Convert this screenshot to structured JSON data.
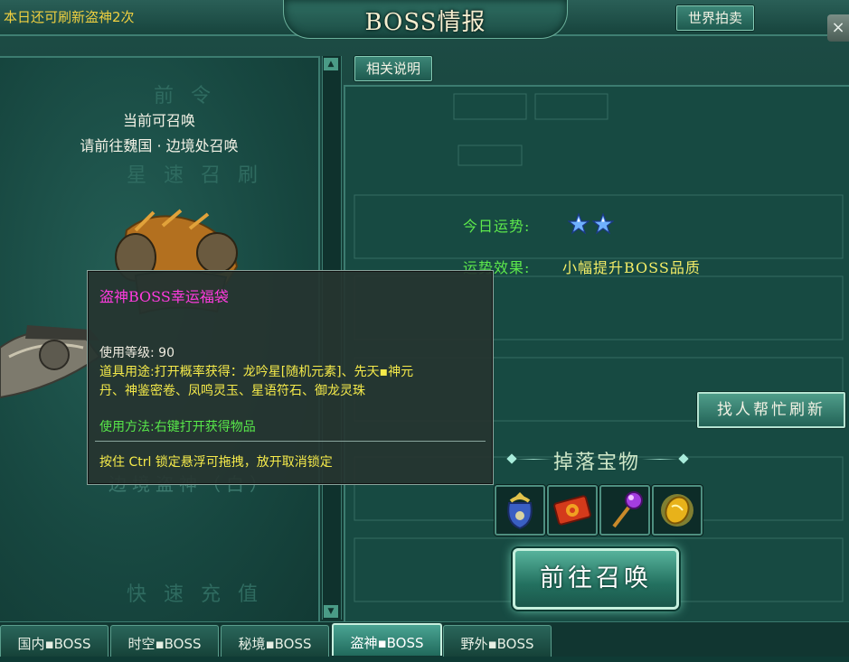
{
  "header": {
    "refresh_notice": "本日还可刷新盗神2次",
    "title": "BOSS情报",
    "world_auction_label": "世界拍卖",
    "close_symbol": "×"
  },
  "left_panel": {
    "summon_status": "当前可召唤",
    "summon_location": "请前往魏国 · 边境处召唤",
    "boss_name": "边境盗神（白）",
    "faint_top_text": "前 令",
    "faint_mid_text": "星 速 召 刷",
    "faint_bottom_text": "快 速 充 值"
  },
  "right_panel": {
    "explain_tab_label": "相关说明",
    "luck_today_label": "今日运势:",
    "luck_stars": 2,
    "luck_effect_label": "运势效果:",
    "luck_effect_value": "小幅提升BOSS品质",
    "help_refresh_label": "找人帮忙刷新",
    "drops_title": "掉落宝物",
    "drop_items": [
      "blue-pouch-icon",
      "red-token-icon",
      "purple-scepter-icon",
      "golden-jade-icon"
    ],
    "summon_button_label": "前往召唤"
  },
  "tooltip": {
    "title": "盗神BOSS幸运福袋",
    "level_line": "使用等级: 90",
    "usage_line1": "道具用途:打开概率获得：龙吟星[随机元素]、先天▪神元",
    "usage_line2": "丹、神鉴密卷、凤鸣灵玉、星语符石、御龙灵珠",
    "method_line": "使用方法:右键打开获得物品",
    "lock_hint": "按住 Ctrl 锁定悬浮可拖拽，放开取消锁定"
  },
  "bottom_tabs": [
    {
      "label": "国内▪BOSS",
      "active": false
    },
    {
      "label": "时空▪BOSS",
      "active": false
    },
    {
      "label": "秘境▪BOSS",
      "active": false
    },
    {
      "label": "盗神▪BOSS",
      "active": true
    },
    {
      "label": "野外▪BOSS",
      "active": false
    }
  ],
  "colors": {
    "accent_green": "#5de84c",
    "accent_yellow": "#f4ed67",
    "tooltip_title": "#ff3bdf",
    "frame_teal": "#174a42"
  }
}
